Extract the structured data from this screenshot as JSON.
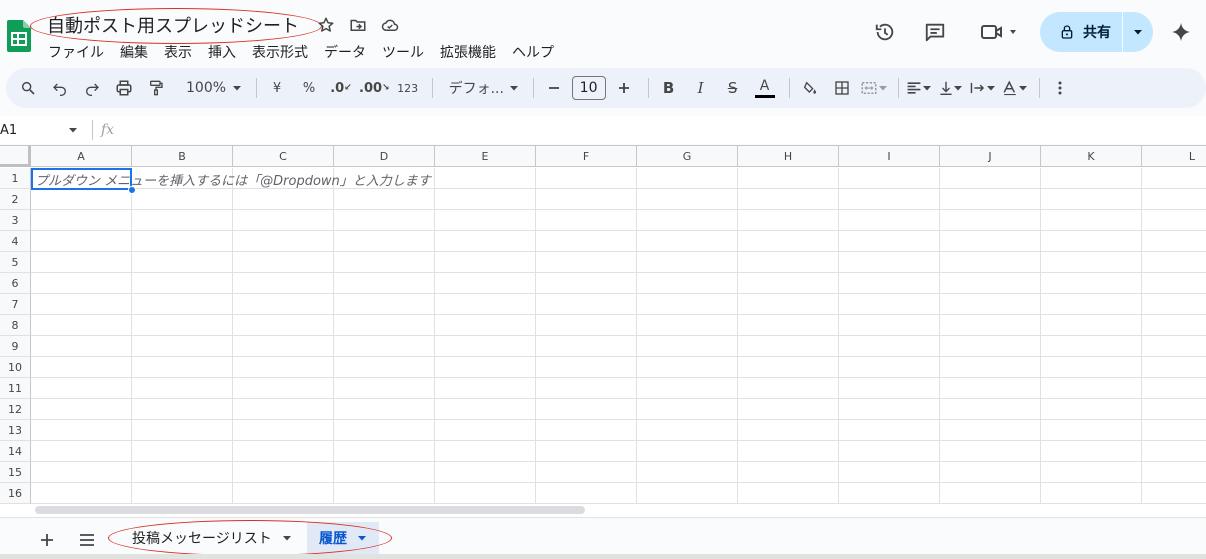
{
  "document": {
    "title": "自動ポスト用スプレッドシート"
  },
  "menu": [
    "ファイル",
    "編集",
    "表示",
    "挿入",
    "表示形式",
    "データ",
    "ツール",
    "拡張機能",
    "ヘルプ"
  ],
  "header_right": {
    "share_label": "共有"
  },
  "toolbar": {
    "zoom": "100%",
    "currency": "¥",
    "percent": "%",
    "decimal_decrease": ".0",
    "decimal_increase": ".00",
    "number_format": "123",
    "font": "デフォ...",
    "font_size": "10",
    "bold": "B",
    "italic": "I",
    "strike": "S",
    "text_color": "A",
    "text_color_value": "#000000"
  },
  "formula_bar": {
    "name_box": "A1",
    "fx": "fx"
  },
  "grid": {
    "columns": [
      "A",
      "B",
      "C",
      "D",
      "E",
      "F",
      "G",
      "H",
      "I",
      "J",
      "K",
      "L"
    ],
    "rows": [
      "1",
      "2",
      "3",
      "4",
      "5",
      "6",
      "7",
      "8",
      "9",
      "10",
      "11",
      "12",
      "13",
      "14",
      "15",
      "16"
    ],
    "a1_hint": "プルダウン メニューを挿入するには「@Dropdown」と入力します"
  },
  "sheets": {
    "tabs": [
      {
        "label": "投稿メッセージリスト",
        "active": false
      },
      {
        "label": "履歴",
        "active": true
      }
    ]
  },
  "colors": {
    "accent": "#1a73e8",
    "share_bg": "#c2e7ff",
    "annotation": "#d93025"
  }
}
